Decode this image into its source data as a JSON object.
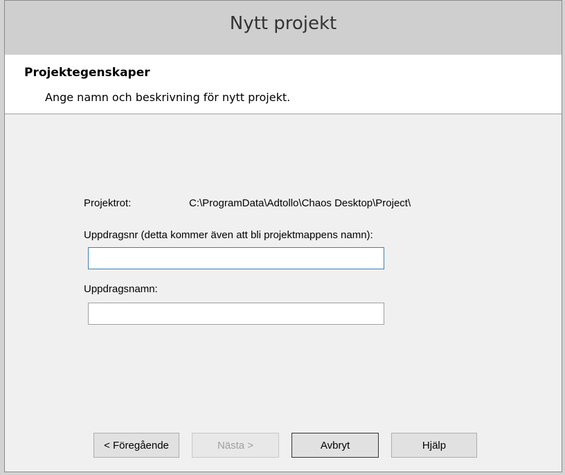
{
  "window": {
    "title": "Nytt projekt"
  },
  "header": {
    "title": "Projektegenskaper",
    "subtitle": "Ange namn och beskrivning för nytt projekt."
  },
  "form": {
    "project_root_label": "Projektrot:",
    "project_root_value": "C:\\ProgramData\\Adtollo\\Chaos Desktop\\Project\\",
    "assignment_number_label": "Uppdragsnr (detta kommer även att bli projektmappens namn):",
    "assignment_number_value": "",
    "assignment_name_label": "Uppdragsnamn:",
    "assignment_name_value": ""
  },
  "buttons": {
    "previous": "< Föregående",
    "next": "Nästa >",
    "cancel": "Avbryt",
    "help": "Hjälp"
  }
}
